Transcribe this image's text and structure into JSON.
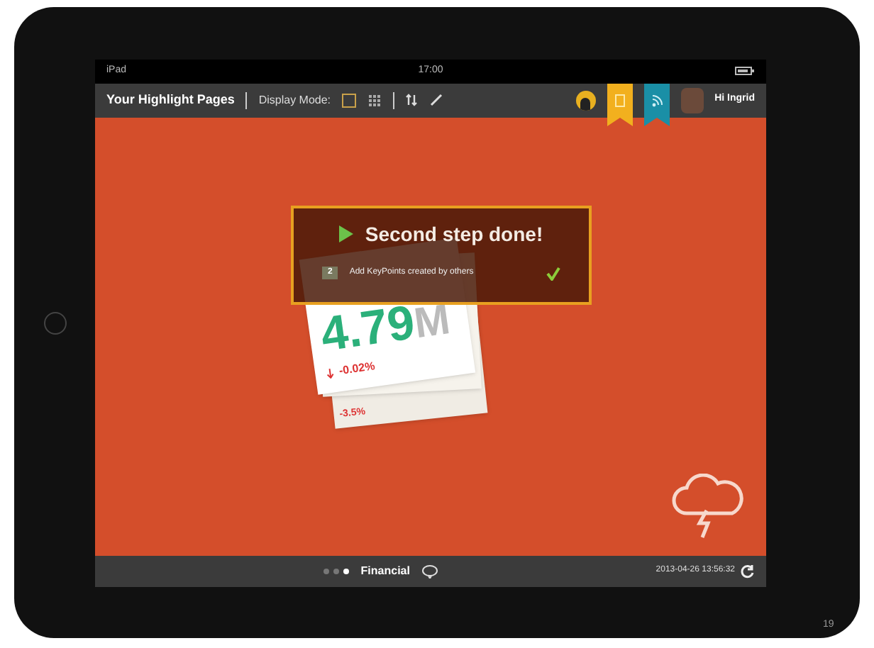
{
  "status_bar": {
    "device": "iPad",
    "time": "17:00"
  },
  "toolbar": {
    "title": "Your Highlight Pages",
    "display_mode_label": "Display Mode:",
    "display_modes": [
      {
        "kind": "single",
        "selected": true
      },
      {
        "kind": "grid",
        "selected": false
      }
    ],
    "greeting": "Hi Ingrid"
  },
  "notification": {
    "title": "Second step done!",
    "step_number": "2",
    "step_text": "Add KeyPoints created by others",
    "done": true
  },
  "card": {
    "value": "4.79",
    "unit": "M",
    "change": "-0.02%",
    "back_change": "-3.5%"
  },
  "bottom_bar": {
    "pages": [
      {
        "selected": false
      },
      {
        "selected": false
      },
      {
        "selected": true
      }
    ],
    "category": "Financial",
    "timestamp": "2013-04-26 13:56:32"
  },
  "page_number": "19"
}
